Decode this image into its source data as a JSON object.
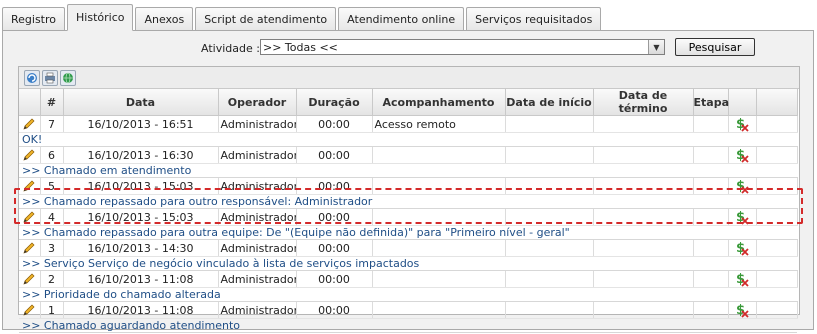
{
  "tabs": [
    {
      "label": "Registro",
      "active": false
    },
    {
      "label": "Histórico",
      "active": true
    },
    {
      "label": "Anexos",
      "active": false
    },
    {
      "label": "Script de atendimento",
      "active": false
    },
    {
      "label": "Atendimento online",
      "active": false
    },
    {
      "label": "Serviços requisitados",
      "active": false
    }
  ],
  "filter": {
    "label": "Atividade :",
    "selected": ">> Todas <<",
    "search_label": "Pesquisar"
  },
  "toolbar_icons": [
    "refresh-icon",
    "print-icon",
    "globe-icon"
  ],
  "columns": [
    "",
    "#",
    "Data",
    "Operador",
    "Duração",
    "Acompanhamento",
    "Data de início",
    "Data de término",
    "Etapa",
    "",
    ""
  ],
  "rows": [
    {
      "num": "7",
      "date": "16/10/2013 - 16:51",
      "operator": "Administrador",
      "duration": "00:00",
      "followup": "Acesso remoto",
      "note": "OK!"
    },
    {
      "num": "6",
      "date": "16/10/2013 - 16:30",
      "operator": "Administrador",
      "duration": "00:00",
      "followup": "",
      "note": ">> Chamado em atendimento"
    },
    {
      "num": "5",
      "date": "16/10/2013 - 15:03",
      "operator": "Administrador",
      "duration": "00:00",
      "followup": "",
      "note": ">> Chamado repassado para outro responsável: Administrador"
    },
    {
      "num": "4",
      "date": "16/10/2013 - 15:03",
      "operator": "Administrador",
      "duration": "00:00",
      "followup": "",
      "note": ">> Chamado repassado para outra equipe: De \"(Equipe não definida)\" para \"Primeiro nível - geral\""
    },
    {
      "num": "3",
      "date": "16/10/2013 - 14:30",
      "operator": "Administrador",
      "duration": "00:00",
      "followup": "",
      "note": ">> Serviço Serviço de negócio vinculado à lista de serviços impactados"
    },
    {
      "num": "2",
      "date": "16/10/2013 - 11:08",
      "operator": "Administrador",
      "duration": "00:00",
      "followup": "",
      "note": ">> Prioridade do chamado alterada"
    },
    {
      "num": "1",
      "date": "16/10/2013 - 11:08",
      "operator": "Administrador",
      "duration": "00:00",
      "followup": "",
      "note": ">> Chamado aguardando atendimento"
    }
  ],
  "colors": {
    "note_text": "#1f4e86",
    "highlight": "#d42a2a"
  }
}
